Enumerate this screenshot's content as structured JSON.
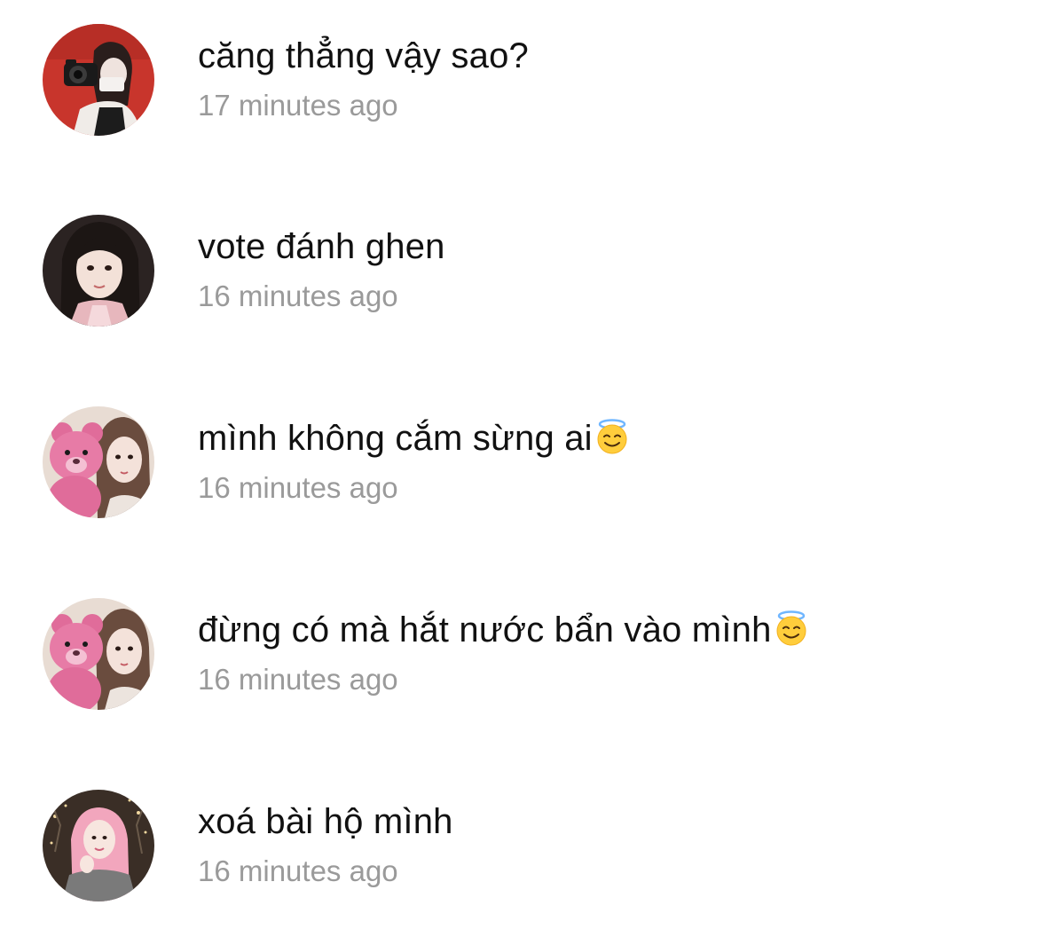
{
  "comments": [
    {
      "text": "căng thẳng vậy sao?",
      "time": "17 minutes ago",
      "emoji": ""
    },
    {
      "text": "vote đánh ghen",
      "time": "16 minutes ago",
      "emoji": ""
    },
    {
      "text": "mình không cắm sừng ai",
      "time": "16 minutes ago",
      "emoji": "smiling-face-with-halo"
    },
    {
      "text": "đừng có mà hắt nước bẩn vào mình",
      "time": "16 minutes ago",
      "emoji": "smiling-face-with-halo"
    },
    {
      "text": "xoá bài hộ mình",
      "time": "16 minutes ago",
      "emoji": ""
    }
  ],
  "colors": {
    "comment_text": "#111111",
    "timestamp_text": "#9a9a9a",
    "background": "#ffffff"
  }
}
